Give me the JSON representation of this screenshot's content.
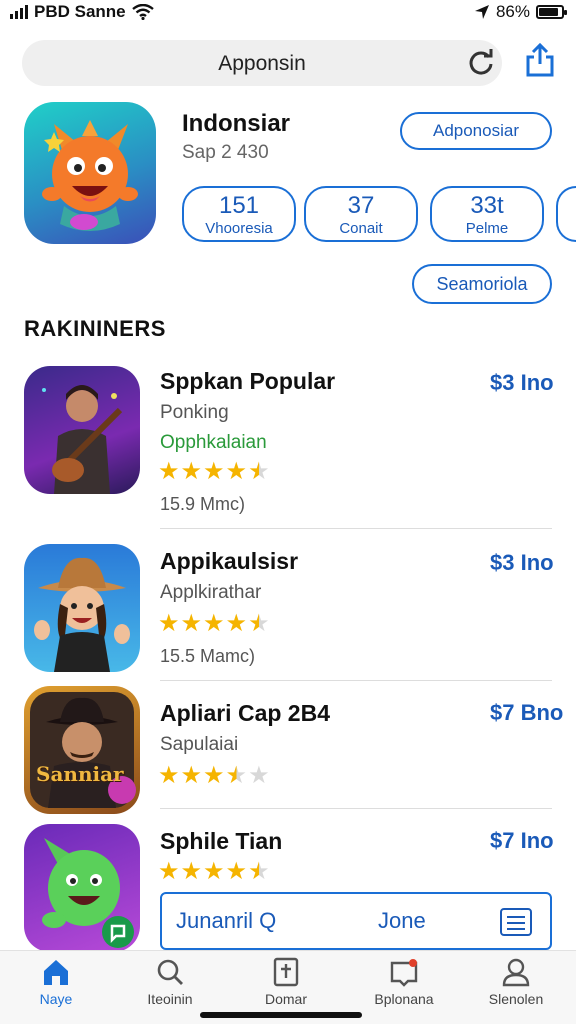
{
  "status_bar": {
    "carrier": "PBD Sanne",
    "battery": "86%",
    "battery_level": 0.86
  },
  "search_bar": {
    "text": "Apponsin"
  },
  "hero": {
    "title": "Indonsiar",
    "subtitle": "Sap 2 430",
    "button": "Adponosiar",
    "stats": [
      {
        "value": "151",
        "label": "Vhooresia"
      },
      {
        "value": "37",
        "label": "Conait"
      },
      {
        "value": "33t",
        "label": "Pelme"
      }
    ],
    "see_all": "Seamoriola"
  },
  "section_title": "RAKININERS",
  "apps": [
    {
      "title": "Sppkan Popular",
      "category": "Ponking",
      "tag": "Opphkalaian",
      "rating": 4.5,
      "size": "15.9 Mmc)",
      "price": "$3 Ino",
      "icon": "guitarist-icon"
    },
    {
      "title": "Appikaulsisr",
      "category": "Applkirathar",
      "rating": 4.5,
      "size": "15.5 Mamc)",
      "price": "$3 Ino",
      "icon": "cowboy-girl-icon"
    },
    {
      "title": "Apliari Cap 2B4",
      "category": "Sapulaiai",
      "rating": 3.5,
      "price": "$7 Bno",
      "icon": "detective-icon",
      "icon_text": "Sanniar"
    },
    {
      "title": "Sphile Tian",
      "rating": 4.5,
      "price": "$7 Ino",
      "icon": "green-creature-icon"
    }
  ],
  "bottom_input": {
    "text": "Junanril Q",
    "text2": "Jone"
  },
  "tabs": [
    {
      "label": "Naye",
      "icon": "home-icon",
      "active": true
    },
    {
      "label": "Iteoinin",
      "icon": "search-icon",
      "active": false
    },
    {
      "label": "Domar",
      "icon": "book-icon",
      "active": false
    },
    {
      "label": "Bplonana",
      "icon": "inbox-icon",
      "active": false
    },
    {
      "label": "Slenolen",
      "icon": "person-icon",
      "active": false
    }
  ],
  "colors": {
    "accent": "#1a6fd6",
    "star": "#f5b400",
    "tag_green": "#2a9a3a"
  }
}
